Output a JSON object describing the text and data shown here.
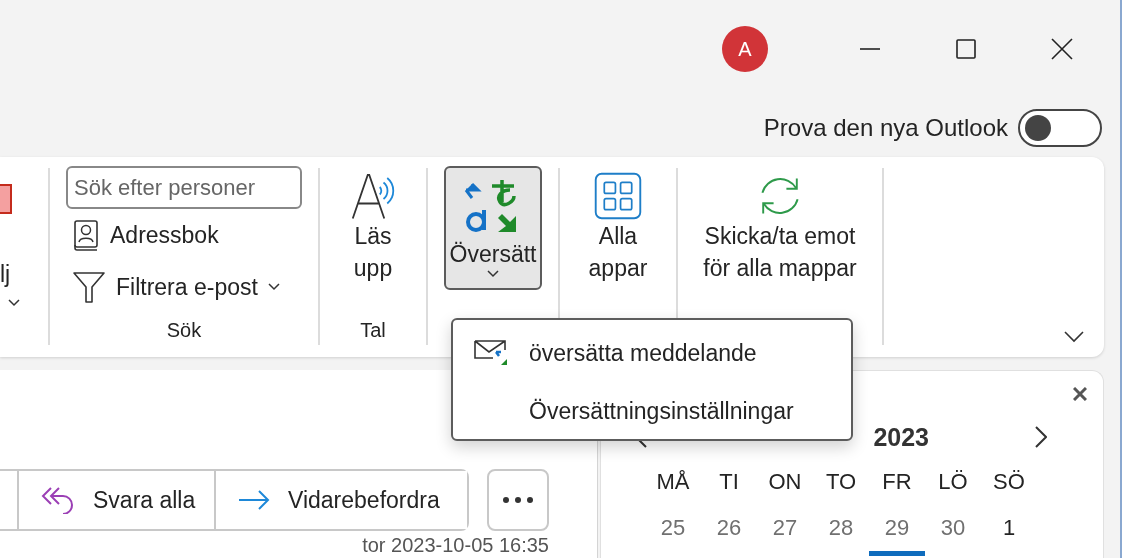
{
  "window": {
    "avatar": "A",
    "controls": [
      {
        "kind": "minimize"
      },
      {
        "kind": "maximize"
      },
      {
        "kind": "close"
      }
    ]
  },
  "new_outlook": {
    "label": "Prova den nya Outlook",
    "on": false
  },
  "ribbon": {
    "groups": [
      {
        "kind": "partial",
        "items": [
          {
            "label": "lj"
          }
        ]
      },
      {
        "kind": "search",
        "label": "Sök",
        "search": {
          "placeholder": "Sök efter personer"
        },
        "items": [
          {
            "label": "Adressbok",
            "dropdown": false
          },
          {
            "label": "Filtrera e-post",
            "dropdown": true
          }
        ]
      },
      {
        "kind": "large",
        "label": "Tal",
        "buttons": [
          {
            "label": "Läs upp",
            "selected": false,
            "dropdown": false
          }
        ]
      },
      {
        "kind": "large",
        "buttons": [
          {
            "label": "Översätt",
            "selected": true,
            "dropdown": true
          }
        ]
      },
      {
        "kind": "large",
        "buttons": [
          {
            "label": "Alla appar",
            "selected": false,
            "dropdown": false
          }
        ]
      },
      {
        "kind": "large",
        "buttons": [
          {
            "label": "Skicka/ta emot för alla mappar",
            "selected": false,
            "dropdown": false
          }
        ]
      }
    ]
  },
  "translate_menu": {
    "items": [
      {
        "label": "översätta meddelande"
      },
      {
        "label": "Översättningsinställningar"
      }
    ]
  },
  "message_actions": {
    "buttons": [
      {
        "label": "Svara alla"
      },
      {
        "label": "Vidarebefordra"
      }
    ]
  },
  "timestamp": "tor 2023-10-05 16:35",
  "calendar": {
    "month": "2023",
    "weekdays": [
      "MÅ",
      "TI",
      "ON",
      "TO",
      "FR",
      "LÖ",
      "SÖ"
    ],
    "days": [
      {
        "day": "25",
        "current_month": false,
        "selected": false
      },
      {
        "day": "26",
        "current_month": false,
        "selected": false
      },
      {
        "day": "27",
        "current_month": false,
        "selected": false
      },
      {
        "day": "28",
        "current_month": false,
        "selected": false
      },
      {
        "day": "29",
        "current_month": false,
        "selected": true
      },
      {
        "day": "30",
        "current_month": false,
        "selected": false
      },
      {
        "day": "1",
        "current_month": true,
        "selected": false
      }
    ]
  }
}
